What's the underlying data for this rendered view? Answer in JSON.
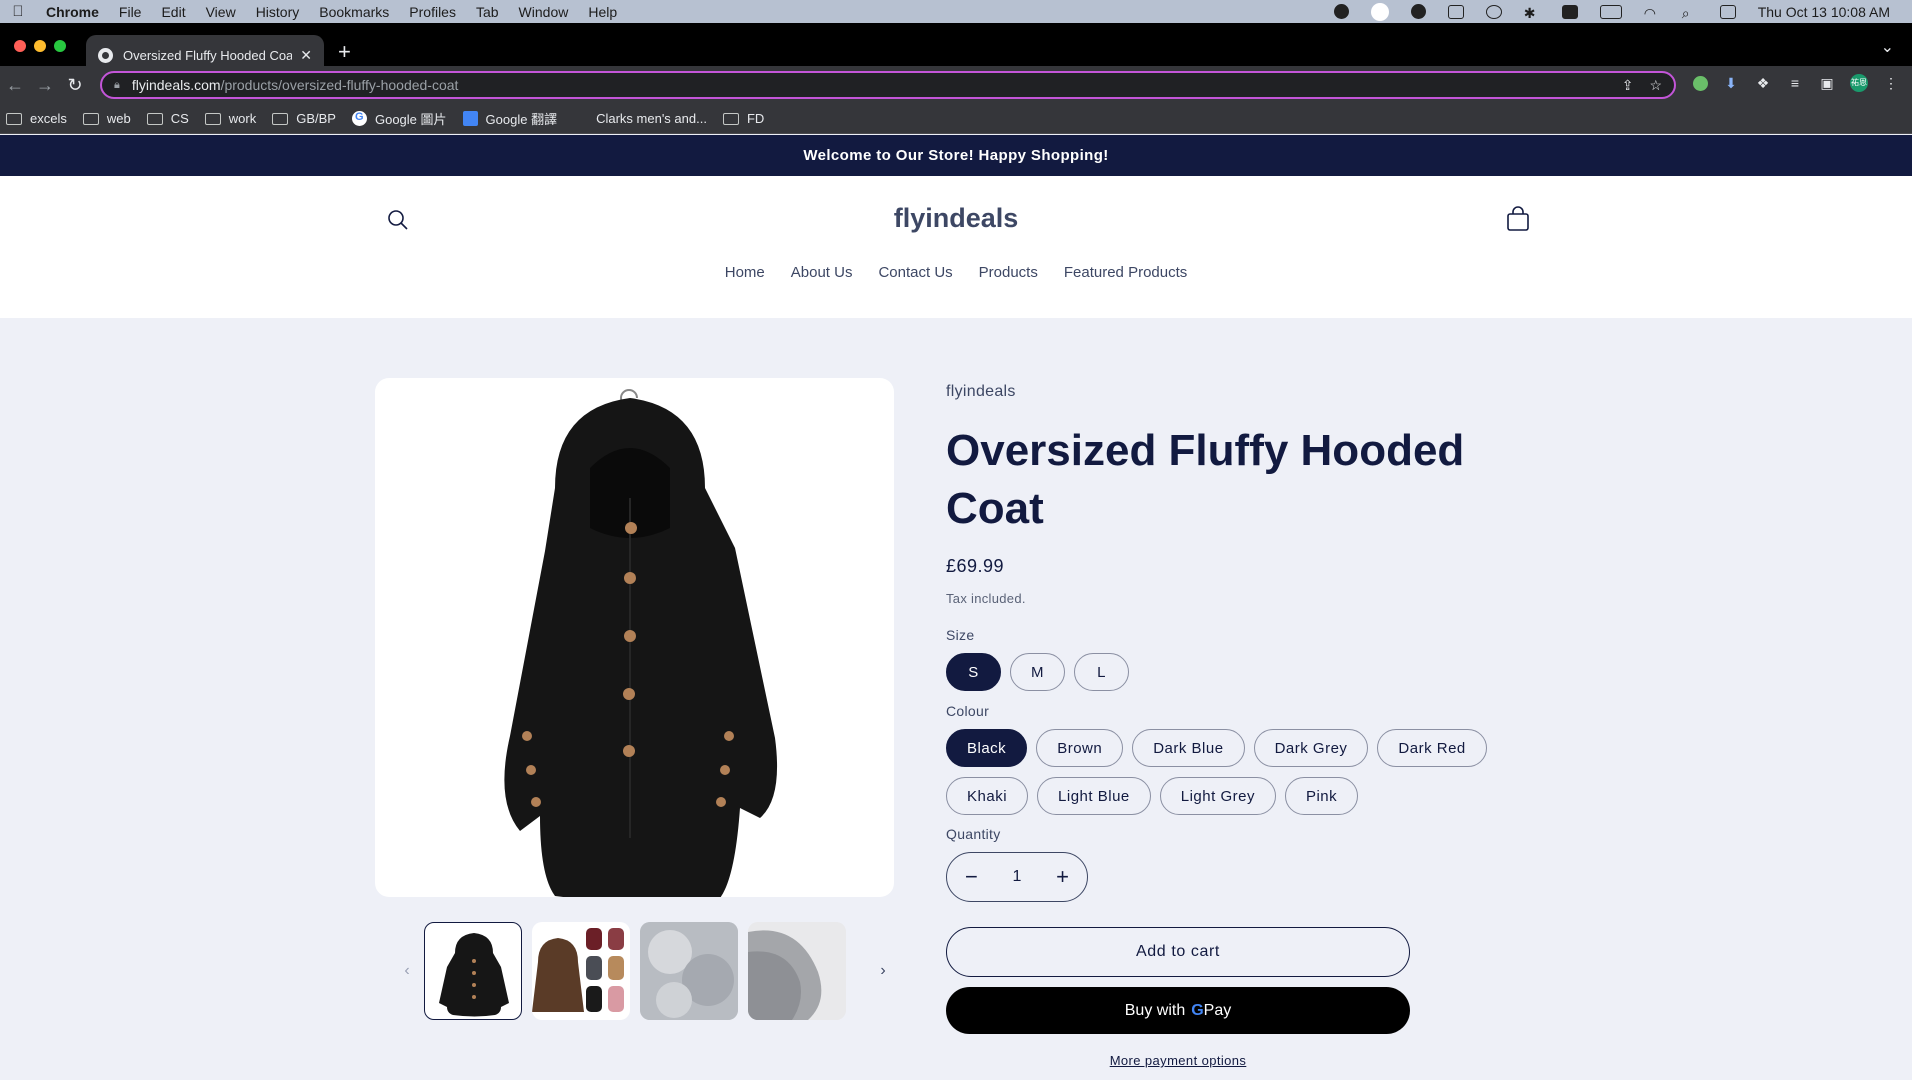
{
  "menubar": {
    "app": "Chrome",
    "items": [
      "File",
      "Edit",
      "View",
      "History",
      "Bookmarks",
      "Profiles",
      "Tab",
      "Window",
      "Help"
    ],
    "clock": "Thu Oct 13  10:08 AM"
  },
  "browser": {
    "tab_title": "Oversized Fluffy Hooded Coat",
    "url_host": "flyindeals.com",
    "url_path": "/products/oversized-fluffy-hooded-coat",
    "avatar_text": "祐恩",
    "bookmarks": [
      "excels",
      "web",
      "CS",
      "work",
      "GB/BP",
      "Google 圖片",
      "Google 翻譯",
      "Clarks men's and...",
      "FD"
    ]
  },
  "store": {
    "announcement": "Welcome to Our Store! Happy Shopping!",
    "brand": "flyindeals",
    "nav": [
      "Home",
      "About Us",
      "Contact Us",
      "Products",
      "Featured Products"
    ]
  },
  "product": {
    "vendor": "flyindeals",
    "title": "Oversized Fluffy Hooded Coat",
    "price": "£69.99",
    "tax_note": "Tax included.",
    "size_label": "Size",
    "sizes": [
      "S",
      "M",
      "L"
    ],
    "selected_size": "S",
    "colour_label": "Colour",
    "colours": [
      "Black",
      "Brown",
      "Dark Blue",
      "Dark Grey",
      "Dark Red",
      "Khaki",
      "Light Blue",
      "Light Grey",
      "Pink"
    ],
    "selected_colour": "Black",
    "quantity_label": "Quantity",
    "quantity": "1",
    "add_to_cart": "Add to cart",
    "buy_with": "Buy with",
    "pay_brand_g": "G",
    "pay_brand": "Pay",
    "more_payment": "More payment options"
  },
  "colors": {
    "navy": "#121a40",
    "page_bg": "#eef0f7",
    "omnibox_border": "#c355d8"
  }
}
